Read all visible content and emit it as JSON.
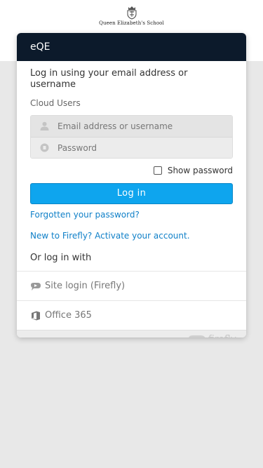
{
  "school": {
    "name": "Queen Elizabeth's School"
  },
  "card": {
    "title": "eQE",
    "heading": "Log in using your email address or username",
    "section_label": "Cloud Users"
  },
  "login": {
    "username_placeholder": "Email address or username",
    "password_placeholder": "Password",
    "show_password_label": "Show password",
    "show_password_checked": false,
    "button_label": "Log in",
    "forgot_link": "Forgotten your password?",
    "activate_link": "New to Firefly? Activate your account."
  },
  "alt_login": {
    "label": "Or log in with",
    "providers": [
      {
        "label": "Site login (Firefly)",
        "icon": "firefly-icon"
      },
      {
        "label": "Office 365",
        "icon": "office-icon"
      }
    ]
  },
  "footer": {
    "brand": "firefly"
  },
  "colors": {
    "header_bg": "#0c1a2b",
    "primary_button": "#0ea5ee",
    "link": "#1080c8",
    "page_bg": "#e8e8e8"
  }
}
